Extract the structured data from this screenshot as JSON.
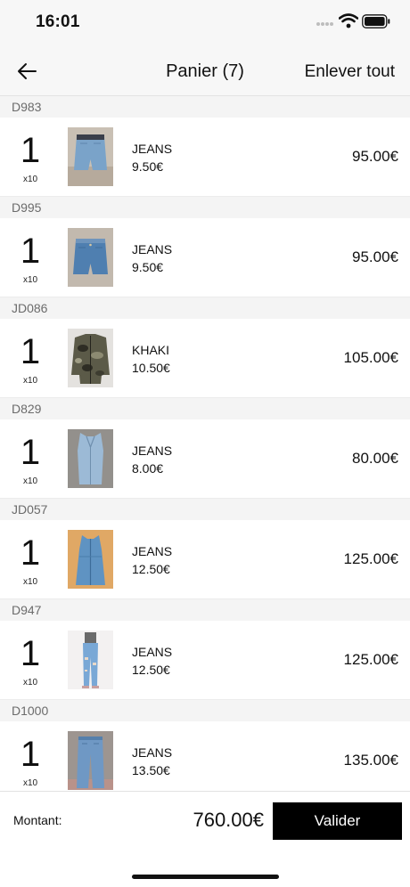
{
  "status_bar": {
    "time": "16:01"
  },
  "nav": {
    "back_icon": "arrow-left-icon",
    "title": "Panier (7)",
    "clear_all": "Enlever tout"
  },
  "items": [
    {
      "ref": "D983",
      "qty": "1",
      "multiplier": "x10",
      "color": "JEANS",
      "unit_price": "9.50€",
      "total": "95.00€",
      "thumb": "denim-shorts"
    },
    {
      "ref": "D995",
      "qty": "1",
      "multiplier": "x10",
      "color": "JEANS",
      "unit_price": "9.50€",
      "total": "95.00€",
      "thumb": "denim-shorts"
    },
    {
      "ref": "JD086",
      "qty": "1",
      "multiplier": "x10",
      "color": "KHAKI",
      "unit_price": "10.50€",
      "total": "105.00€",
      "thumb": "camo-jacket"
    },
    {
      "ref": "D829",
      "qty": "1",
      "multiplier": "x10",
      "color": "JEANS",
      "unit_price": "8.00€",
      "total": "80.00€",
      "thumb": "denim-vest"
    },
    {
      "ref": "JD057",
      "qty": "1",
      "multiplier": "x10",
      "color": "JEANS",
      "unit_price": "12.50€",
      "total": "125.00€",
      "thumb": "denim-dress"
    },
    {
      "ref": "D947",
      "qty": "1",
      "multiplier": "x10",
      "color": "JEANS",
      "unit_price": "12.50€",
      "total": "125.00€",
      "thumb": "ripped-jeans"
    },
    {
      "ref": "D1000",
      "qty": "1",
      "multiplier": "x10",
      "color": "JEANS",
      "unit_price": "13.50€",
      "total": "135.00€",
      "thumb": "denim-jeans"
    }
  ],
  "footer": {
    "amount_label": "Montant:",
    "amount_value": "760.00€",
    "validate": "Valider"
  },
  "colors": {
    "accent": "#000000",
    "section_bg": "#f4f4f4",
    "bar_bg": "#f7f7f7"
  }
}
